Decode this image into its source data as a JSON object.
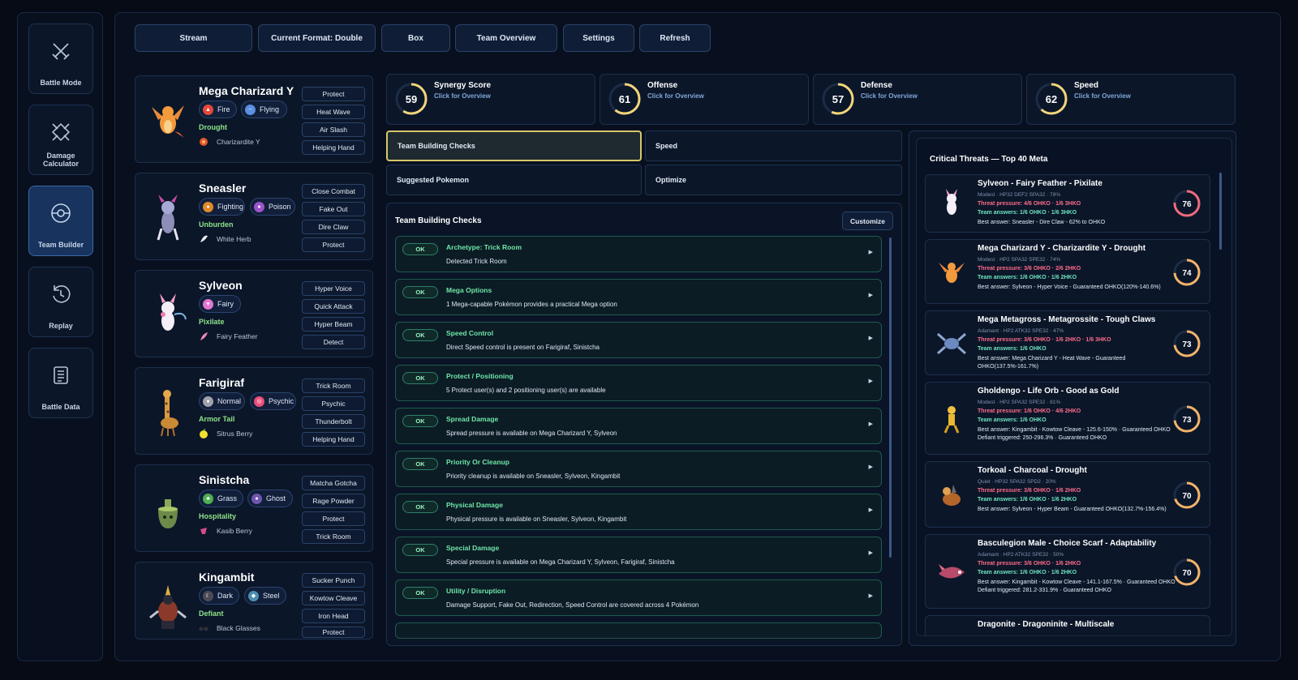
{
  "nav": [
    {
      "label": "Battle Mode",
      "icon": "crossed-swords-icon",
      "active": false
    },
    {
      "label": "Damage Calculator",
      "icon": "target-crosshair-icon",
      "active": false
    },
    {
      "label": "Team Builder",
      "icon": "pokeball-icon",
      "active": true
    },
    {
      "label": "Replay",
      "icon": "replay-icon",
      "active": false
    },
    {
      "label": "Battle Data",
      "icon": "data-list-icon",
      "active": false
    }
  ],
  "toolbar": {
    "stream": "Stream",
    "format": "Current Format: Double",
    "box": "Box",
    "overview": "Team Overview",
    "settings": "Settings",
    "refresh": "Refresh"
  },
  "team": [
    {
      "name": "Mega Charizard Y",
      "types": [
        {
          "name": "Fire",
          "color": "#e2493a"
        },
        {
          "name": "Flying",
          "color": "#5b8fe0"
        }
      ],
      "ability": "Drought",
      "item": "Charizardite Y",
      "moves": [
        "Protect",
        "Heat Wave",
        "Air Slash",
        "Helping Hand"
      ]
    },
    {
      "name": "Sneasler",
      "types": [
        {
          "name": "Fighting",
          "color": "#e08a2a"
        },
        {
          "name": "Poison",
          "color": "#9b54c9"
        }
      ],
      "ability": "Unburden",
      "item": "White Herb",
      "moves": [
        "Close Combat",
        "Fake Out",
        "Dire Claw",
        "Protect"
      ]
    },
    {
      "name": "Sylveon",
      "types": [
        {
          "name": "Fairy",
          "color": "#e476d2"
        }
      ],
      "ability": "Pixilate",
      "item": "Fairy Feather",
      "moves": [
        "Hyper Voice",
        "Quick Attack",
        "Hyper Beam",
        "Detect"
      ]
    },
    {
      "name": "Farigiraf",
      "types": [
        {
          "name": "Normal",
          "color": "#9ea3ab"
        },
        {
          "name": "Psychic",
          "color": "#ea4f7a"
        }
      ],
      "ability": "Armor Tail",
      "item": "Sitrus Berry",
      "moves": [
        "Trick Room",
        "Psychic",
        "Thunderbolt",
        "Helping Hand"
      ]
    },
    {
      "name": "Sinistcha",
      "types": [
        {
          "name": "Grass",
          "color": "#4caf50"
        },
        {
          "name": "Ghost",
          "color": "#6f57b0"
        }
      ],
      "ability": "Hospitality",
      "item": "Kasib Berry",
      "moves": [
        "Matcha Gotcha",
        "Rage Powder",
        "Protect",
        "Trick Room"
      ]
    },
    {
      "name": "Kingambit",
      "types": [
        {
          "name": "Dark",
          "color": "#4e4a55"
        },
        {
          "name": "Steel",
          "color": "#4c8fb0"
        }
      ],
      "ability": "Defiant",
      "item": "Black Glasses",
      "moves": [
        "Sucker Punch",
        "Kowtow Cleave",
        "Iron Head",
        "Protect"
      ]
    }
  ],
  "scores": [
    {
      "title": "Synergy Score",
      "subtitle": "Click for Overview",
      "value": 59,
      "fraction": 0.59
    },
    {
      "title": "Offense",
      "subtitle": "Click for Overview",
      "value": 61,
      "fraction": 0.61
    },
    {
      "title": "Defense",
      "subtitle": "Click for Overview",
      "value": 57,
      "fraction": 0.57
    },
    {
      "title": "Speed",
      "subtitle": "Click for Overview",
      "value": 62,
      "fraction": 0.62
    }
  ],
  "check_tabs": {
    "team_building_checks": "Team Building Checks",
    "speed": "Speed",
    "suggested": "Suggested Pokemon",
    "optimize": "Optimize"
  },
  "checks_panel": {
    "title": "Team Building Checks",
    "customize": "Customize",
    "items": [
      {
        "status": "OK",
        "title": "Archetype: Trick Room",
        "desc": "Detected Trick Room"
      },
      {
        "status": "OK",
        "title": "Mega Options",
        "desc": "1 Mega-capable Pokémon provides a practical Mega option"
      },
      {
        "status": "OK",
        "title": "Speed Control",
        "desc": "Direct Speed control is present on Farigiraf, Sinistcha"
      },
      {
        "status": "OK",
        "title": "Protect / Positioning",
        "desc": "5 Protect user(s) and 2 positioning user(s) are available"
      },
      {
        "status": "OK",
        "title": "Spread Damage",
        "desc": "Spread pressure is available on Mega Charizard Y, Sylveon"
      },
      {
        "status": "OK",
        "title": "Priority Or Cleanup",
        "desc": "Priority cleanup is available on Sneasler, Sylveon, Kingambit"
      },
      {
        "status": "OK",
        "title": "Physical Damage",
        "desc": "Physical pressure is available on Sneasler, Sylveon, Kingambit"
      },
      {
        "status": "OK",
        "title": "Special Damage",
        "desc": "Special pressure is available on Mega Charizard Y, Sylveon, Farigiraf, Sinistcha"
      },
      {
        "status": "OK",
        "title": "Utility / Disruption",
        "desc": "Damage Support, Fake Out, Redirection, Speed Control are covered across 4 Pokémon"
      }
    ]
  },
  "threats": {
    "title": "Critical Threats — Top 40 Meta",
    "items": [
      {
        "name": "Sylveon - Fairy Feather - Pixilate",
        "stats": "Modest · HP32 DEF2 SPA32 · 78%",
        "pressure": "Threat pressure: 4/6 OHKO · 1/6 3HKO",
        "answers": "Team answers: 1/6 OHKO · 1/6 3HKO",
        "best": "Best answer: Sneasler - Dire Claw - 62% to OHKO",
        "defiant": "",
        "score": 76,
        "fraction": 0.76,
        "color": "#f06a7c"
      },
      {
        "name": "Mega Charizard Y - Charizardite Y - Drought",
        "stats": "Modest · HP2 SPA32 SPE32 · 74%",
        "pressure": "Threat pressure: 3/6 OHKO · 2/6 2HKO",
        "answers": "Team answers: 1/6 OHKO · 1/6 2HKO",
        "best": "Best answer: Sylveon - Hyper Voice - Guaranteed OHKO(120%-140.6%)",
        "defiant": "",
        "score": 74,
        "fraction": 0.74,
        "color": "#f2b36a"
      },
      {
        "name": "Mega Metagross - Metagrossite - Tough Claws",
        "stats": "Adamant · HP2 ATK32 SPE32 · 47%",
        "pressure": "Threat pressure: 3/6 OHKO · 1/6 2HKO · 1/6 3HKO",
        "answers": "Team answers: 1/6 OHKO",
        "best": "Best answer: Mega Charizard Y - Heat Wave - Guaranteed OHKO(137.5%-161.7%)",
        "defiant": "",
        "score": 73,
        "fraction": 0.73,
        "color": "#f2b36a"
      },
      {
        "name": "Gholdengo - Life Orb - Good as Gold",
        "stats": "Modest · HP2 SPA32 SPE32 · 81%",
        "pressure": "Threat pressure: 1/6 OHKO · 4/6 2HKO",
        "answers": "Team answers: 1/6 OHKO",
        "best": "Best answer: Kingambit - Kowtow Cleave - 125.6-150% · Guaranteed OHKO",
        "defiant": "Defiant triggered: 250-296.3% · Guaranteed OHKO",
        "score": 73,
        "fraction": 0.73,
        "color": "#f2b36a"
      },
      {
        "name": "Torkoal - Charcoal - Drought",
        "stats": "Quiet · HP32 SPA32 SPD2 · 20%",
        "pressure": "Threat pressure: 3/6 OHKO · 1/6 2HKO",
        "answers": "Team answers: 1/6 OHKO · 1/6 2HKO",
        "best": "Best answer: Sylveon - Hyper Beam - Guaranteed OHKO(132.7%-156.4%)",
        "defiant": "",
        "score": 70,
        "fraction": 0.7,
        "color": "#f2b36a"
      },
      {
        "name": "Basculegion Male - Choice Scarf - Adaptability",
        "stats": "Adamant · HP2 ATK32 SPE32 · 50%",
        "pressure": "Threat pressure: 3/6 OHKO · 1/6 2HKO",
        "answers": "Team answers: 1/6 OHKO · 1/6 2HKO",
        "best": "Best answer: Kingambit - Kowtow Cleave - 141.1-167.5% · Guaranteed OHKO",
        "defiant": "Defiant triggered: 281.2-331.9% · Guaranteed OHKO",
        "score": 70,
        "fraction": 0.7,
        "color": "#f2b36a"
      },
      {
        "name": "Dragonite - Dragoninite - Multiscale",
        "stats": "",
        "pressure": "",
        "answers": "",
        "best": "",
        "defiant": "",
        "score": null,
        "fraction": null,
        "color": "#f2b36a"
      }
    ]
  }
}
